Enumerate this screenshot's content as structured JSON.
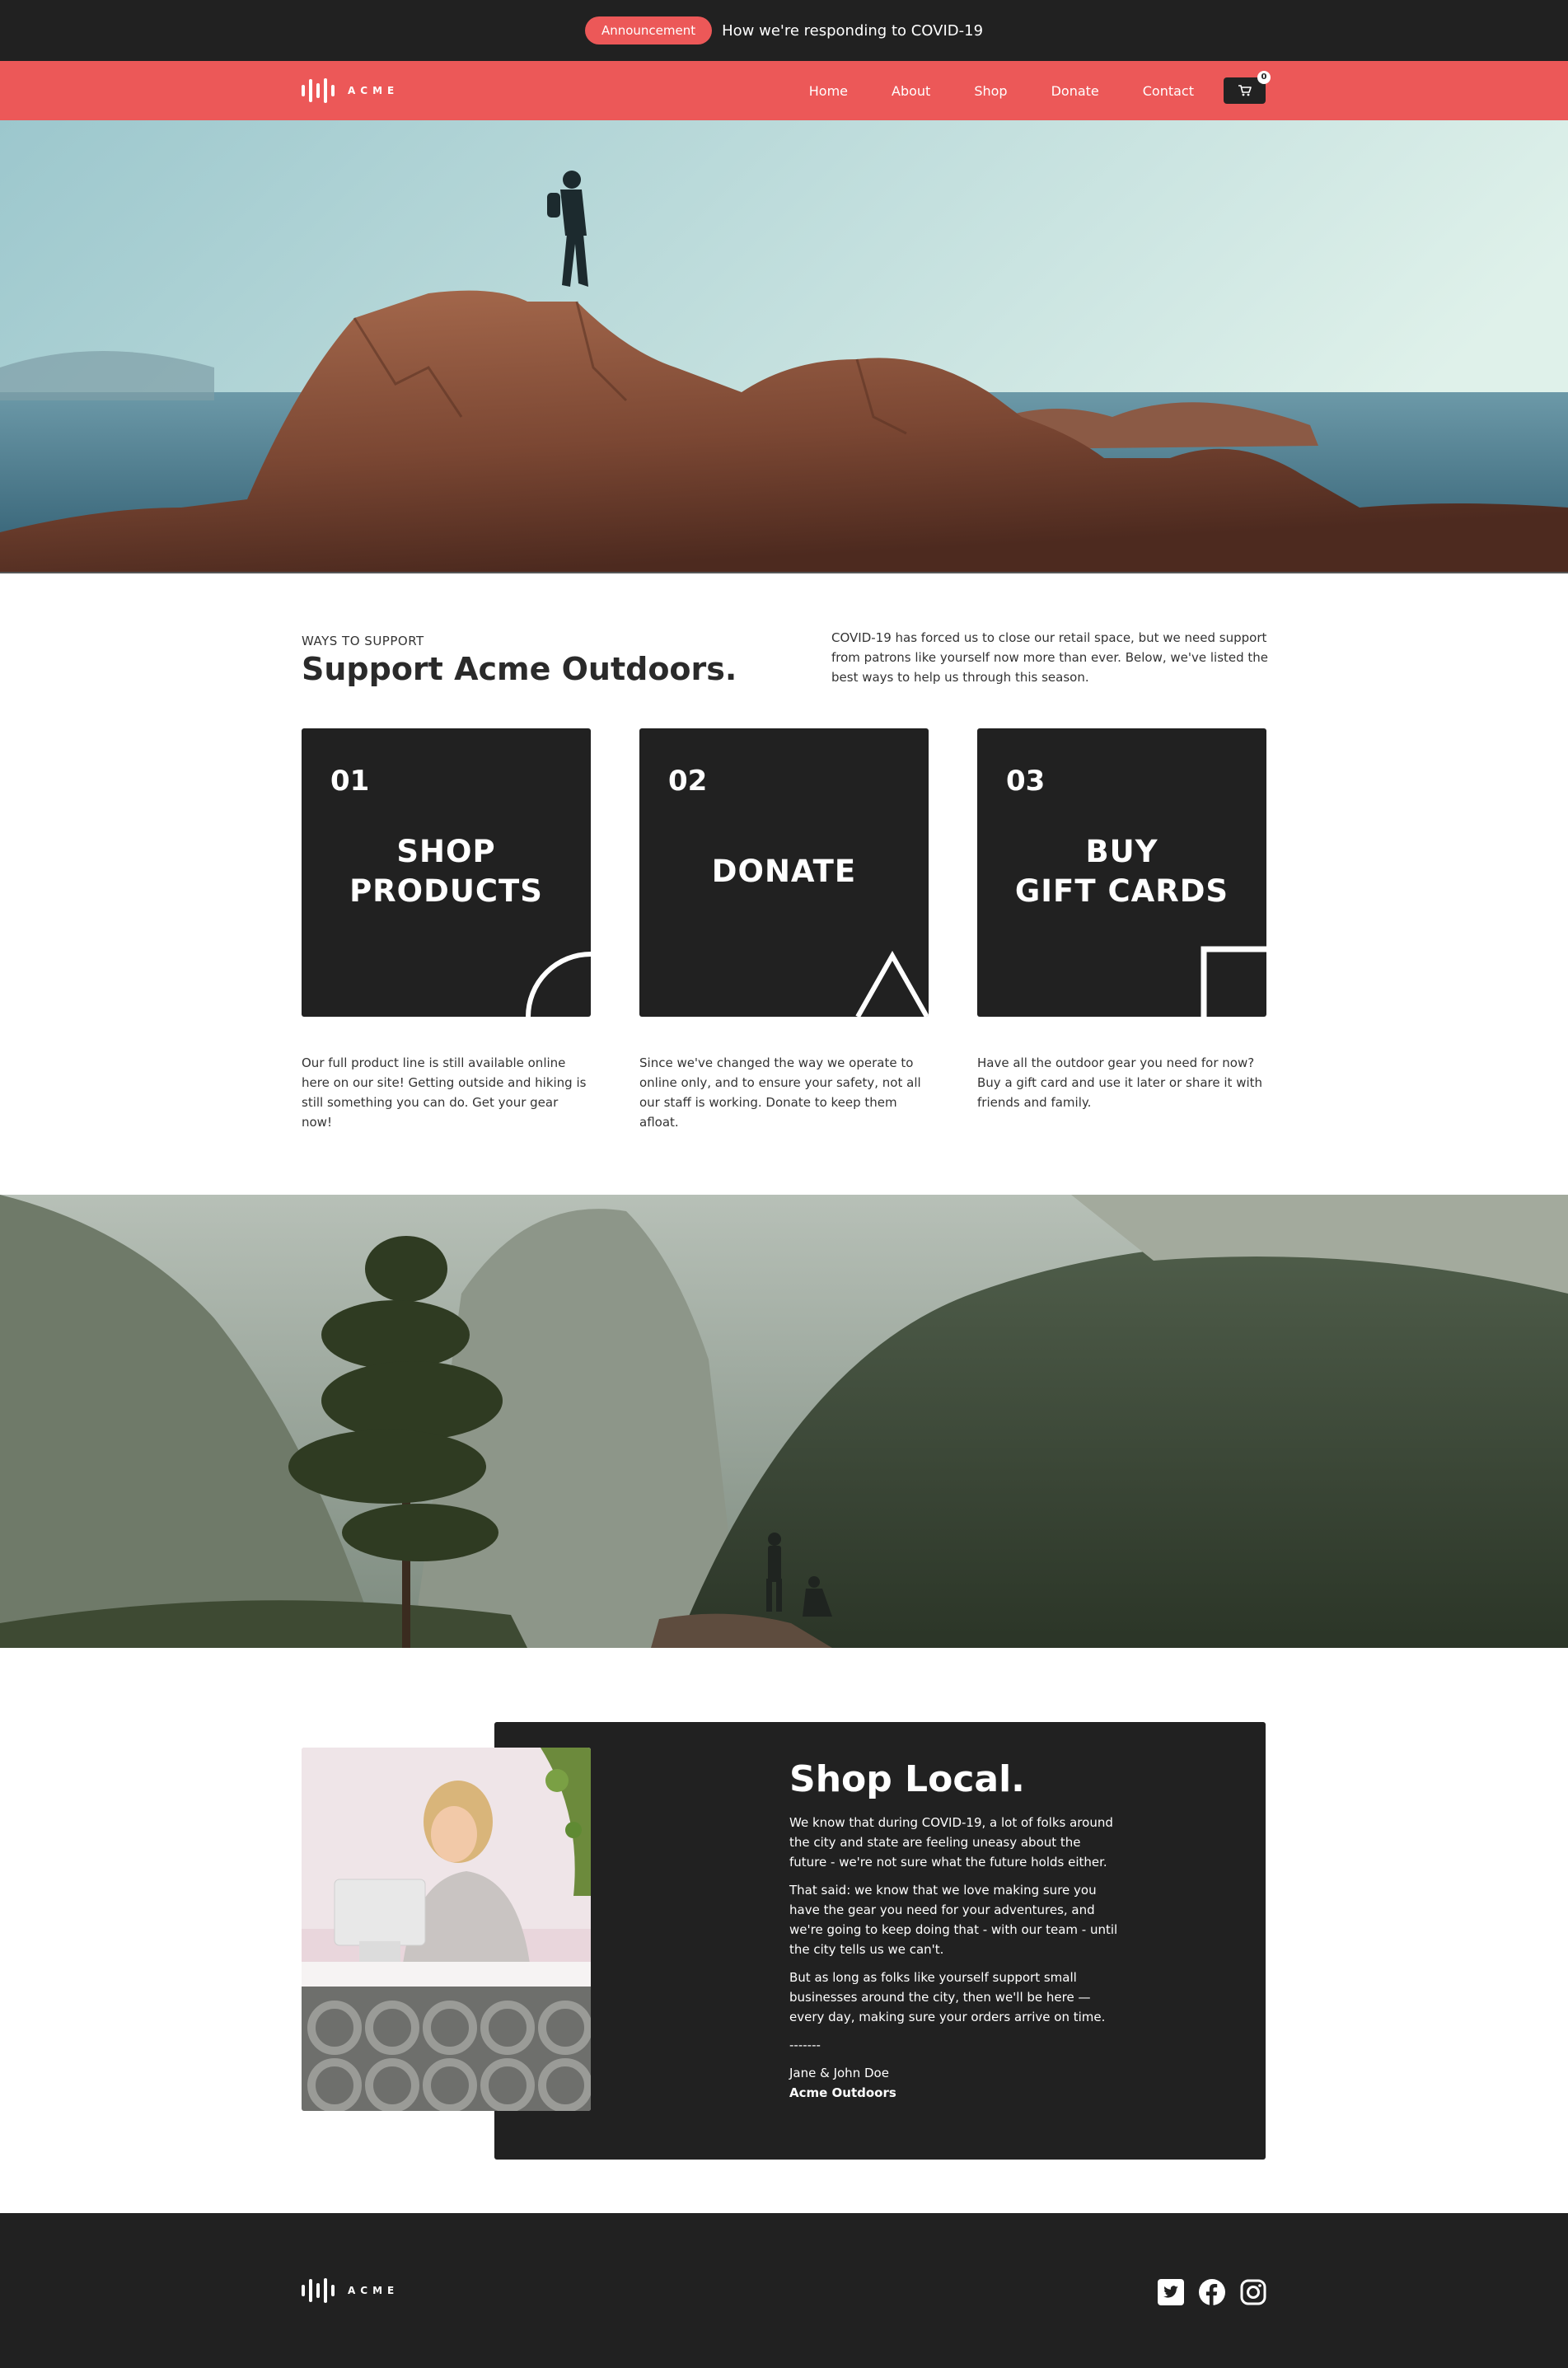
{
  "announcement": {
    "badge": "Announcement",
    "message": "How we're responding to COVID-19"
  },
  "brand": {
    "name": "ACME"
  },
  "nav": {
    "links": [
      "Home",
      "About",
      "Shop",
      "Donate",
      "Contact"
    ],
    "cart_count": "0"
  },
  "hero": {
    "image": "hiker standing on coastal rocks above the sea"
  },
  "support": {
    "eyebrow": "WAYS TO SUPPORT",
    "title": "Support Acme Outdoors.",
    "intro": "COVID-19 has forced us to close our retail space, but we need support from patrons like yourself now more than ever. Below, we've listed the best ways to help us through this season.",
    "cards": [
      {
        "number": "01",
        "label": "SHOP\nPRODUCTS",
        "description": "Our full product line is still available online here on our site! Getting outside and hiking is still something you can do. Get your gear now!"
      },
      {
        "number": "02",
        "label": "DONATE",
        "description": "Since we've changed the way we operate to online only, and to ensure your safety, not all our staff is working. Donate to keep them afloat."
      },
      {
        "number": "03",
        "label": "BUY\nGIFT CARDS",
        "description": "Have all the outdoor gear you need for now? Buy a gift card and use it later or share it with friends and family."
      }
    ]
  },
  "mid_image": {
    "image": "hikers on a rock overlooking a forested mountain valley"
  },
  "shop_local": {
    "title": "Shop Local.",
    "paragraphs": [
      "We know that during COVID-19, a lot of folks around the city and state are feeling uneasy about the future - we're not sure what the future holds either.",
      "That said: we know that we love making sure you have the gear you need for your adventures, and we're going to keep doing that - with our team - until the city tells us we can't.",
      "But as long as folks like yourself support small businesses around the city, then we'll be here — every day, making sure your orders arrive on time."
    ],
    "divider": "-------",
    "signature_name": "Jane & John Doe",
    "signature_company": "Acme Outdoors"
  },
  "footer": {
    "social": [
      "twitter-icon",
      "facebook-icon",
      "instagram-icon"
    ]
  },
  "colors": {
    "accent": "#ec5858",
    "dark": "#212121",
    "white": "#ffffff"
  }
}
